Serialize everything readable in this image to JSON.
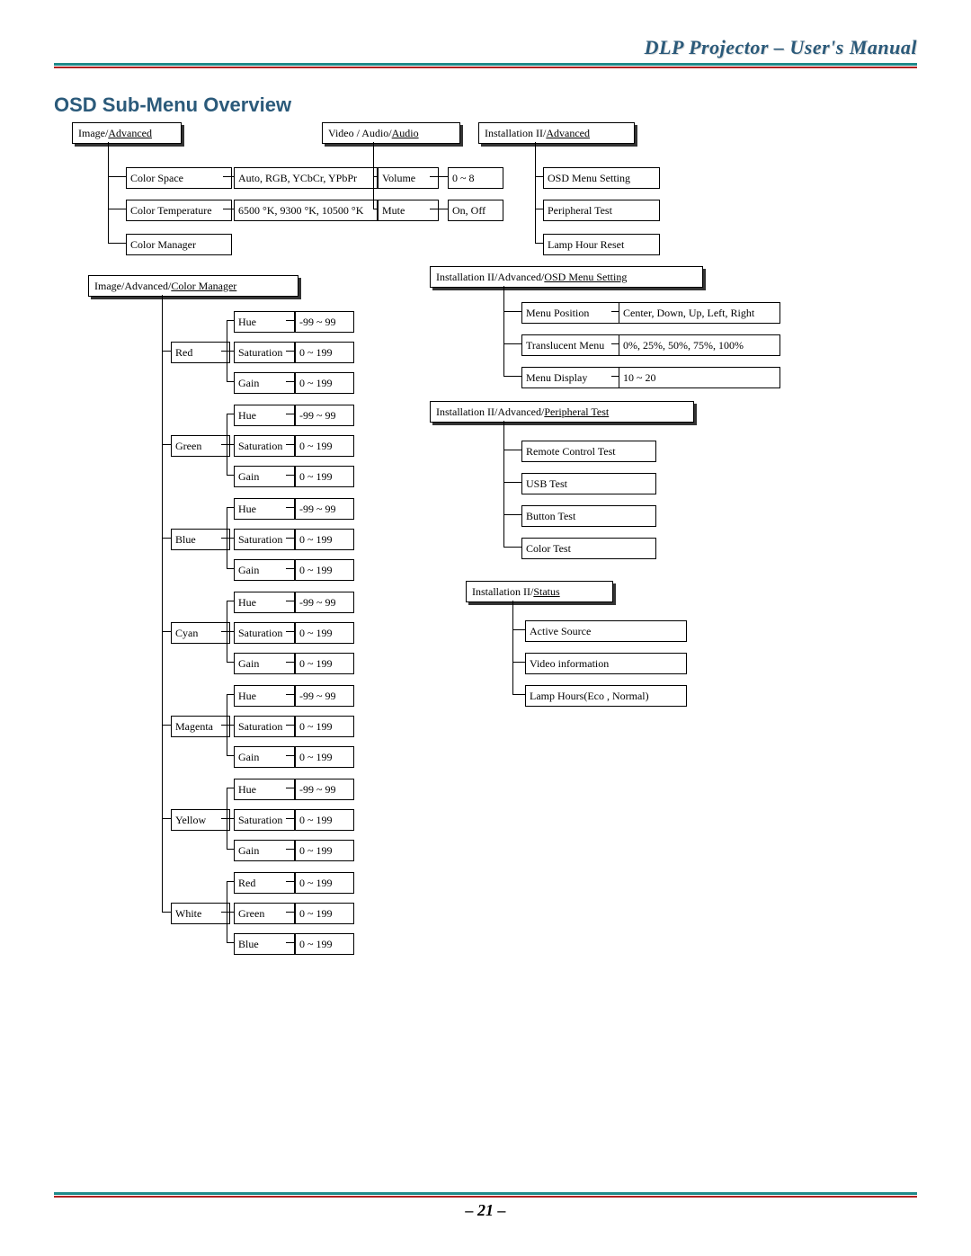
{
  "header": {
    "title": "DLP Projector – User's Manual"
  },
  "section_title": "OSD Sub-Menu Overview",
  "page_number": "– 21 –",
  "bc": {
    "image_advanced": {
      "parts": [
        "Image",
        "Advanced"
      ],
      "cur": 1
    },
    "video_audio": {
      "parts": [
        "Video / Audio",
        "Audio"
      ],
      "cur": 1
    },
    "install_advanced": {
      "parts": [
        "Installation II",
        "Advanced"
      ],
      "cur": 1
    },
    "color_manager": {
      "parts": [
        "Image",
        "Advanced",
        "Color Manager"
      ],
      "cur": 2
    },
    "osd_menu": {
      "parts": [
        "Installation II",
        "Advanced",
        "OSD Menu Setting"
      ],
      "cur": 2
    },
    "peripheral": {
      "parts": [
        "Installation II",
        "Advanced",
        "Peripheral Test"
      ],
      "cur": 2
    },
    "status": {
      "parts": [
        "Installation II",
        "Status"
      ],
      "cur": 1
    }
  },
  "image_advanced": {
    "color_space": {
      "label": "Color Space",
      "values": "Auto, RGB, YCbCr, YPbPr"
    },
    "color_temp": {
      "label": "Color Temperature",
      "values": "6500 °K, 9300 °K, 10500 °K"
    },
    "color_manager": {
      "label": "Color Manager"
    }
  },
  "video_audio": {
    "volume": {
      "label": "Volume",
      "values": "0 ~ 8"
    },
    "mute": {
      "label": "Mute",
      "values": "On, Off"
    }
  },
  "install_adv": {
    "osd": {
      "label": "OSD Menu Setting"
    },
    "peri": {
      "label": "Peripheral Test"
    },
    "lamp": {
      "label": "Lamp Hour Reset"
    }
  },
  "osd_menu": {
    "position": {
      "label": "Menu Position",
      "values": "Center, Down, Up, Left, Right"
    },
    "translucent": {
      "label": "Translucent Menu",
      "values": "0%, 25%, 50%, 75%, 100%"
    },
    "display": {
      "label": "Menu Display",
      "values": "10 ~ 20"
    }
  },
  "peripheral": {
    "remote": "Remote Control Test",
    "usb": "USB Test",
    "button": "Button Test",
    "color": "Color Test"
  },
  "status": {
    "active": "Active Source",
    "video": "Video information",
    "lamp": "Lamp Hours(Eco , Normal)"
  },
  "cm_colors": [
    "Red",
    "Green",
    "Blue",
    "Cyan",
    "Magenta",
    "Yellow"
  ],
  "cm_props": {
    "hue": {
      "label": "Hue",
      "range": "-99 ~ 99"
    },
    "sat": {
      "label": "Saturation",
      "range": "0 ~ 199"
    },
    "gain": {
      "label": "Gain",
      "range": "0 ~ 199"
    }
  },
  "cm_white": {
    "label": "White",
    "red": {
      "label": "Red",
      "range": "0 ~ 199"
    },
    "green": {
      "label": "Green",
      "range": "0 ~ 199"
    },
    "blue": {
      "label": "Blue",
      "range": "0 ~ 199"
    }
  }
}
